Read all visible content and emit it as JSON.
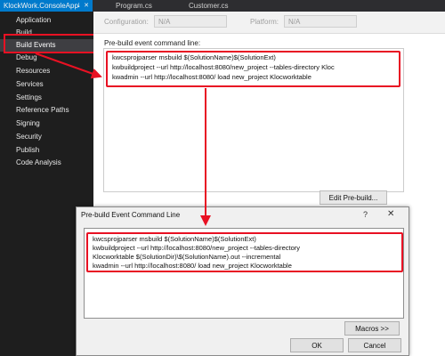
{
  "tabs": {
    "active": "KlockWork.ConsoleApp",
    "active_pin": "⭣",
    "active_close": "✕",
    "program": "Program.cs",
    "customer": "Customer.cs"
  },
  "nav": {
    "items": [
      "Application",
      "Build",
      "Build Events",
      "Debug",
      "Resources",
      "Services",
      "Settings",
      "Reference Paths",
      "Signing",
      "Security",
      "Publish",
      "Code Analysis"
    ],
    "selected": "Build Events"
  },
  "config": {
    "configuration_label": "Configuration:",
    "configuration_value": "N/A",
    "platform_label": "Platform:",
    "platform_value": "N/A"
  },
  "prebuild": {
    "label": "Pre-build event command line:",
    "lines": [
      "kwcsprojparser msbuild $(SolutionName)$(SolutionExt)",
      "kwbuildproject  --url http://localhost:8080/new_project --tables-directory Kloc",
      "kwadmin --url http://localhost:8080/ load new_project Klocworktable"
    ],
    "edit_button": "Edit Pre-build..."
  },
  "dialog": {
    "title": "Pre-build Event Command Line",
    "help": "?",
    "close": "✕",
    "lines": [
      "kwcsprojparser msbuild $(SolutionName)$(SolutionExt)",
      "kwbuildproject  --url http://localhost:8080/new_project --tables-directory",
      "Klocworktable $(SolutionDir)\\$(SolutionName).out --incremental",
      "kwadmin --url http://localhost:8080/ load new_project Klocworktable"
    ],
    "macros_button": "Macros >>",
    "ok_button": "OK",
    "cancel_button": "Cancel"
  },
  "colors": {
    "accent": "#007acc",
    "highlight": "#e81123",
    "nav_bg": "#1e1e1e"
  }
}
